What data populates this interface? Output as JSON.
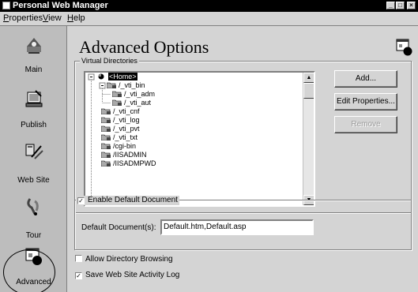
{
  "window": {
    "title": "Personal Web Manager"
  },
  "menu": [
    {
      "label": "Properties",
      "accel": "P"
    },
    {
      "label": "View",
      "accel": "V"
    },
    {
      "label": "Help",
      "accel": "H"
    }
  ],
  "sidebar": {
    "items": [
      {
        "label": "Main",
        "icon": "main-icon"
      },
      {
        "label": "Publish",
        "icon": "publish-icon"
      },
      {
        "label": "Web Site",
        "icon": "web-site-icon"
      },
      {
        "label": "Tour",
        "icon": "tour-icon"
      },
      {
        "label": "Advanced",
        "icon": "advanced-icon",
        "active": true
      }
    ]
  },
  "page": {
    "title": "Advanced Options",
    "virtual_directories_label": "Virtual Directories"
  },
  "tree": {
    "items": [
      {
        "label": "<Home>",
        "selected": true
      },
      {
        "label": "/_vti_bin"
      },
      {
        "label": "/_vti_adm"
      },
      {
        "label": "/_vti_aut"
      },
      {
        "label": "/_vti_cnf"
      },
      {
        "label": "/_vti_log"
      },
      {
        "label": "/_vti_pvt"
      },
      {
        "label": "/_vti_txt"
      },
      {
        "label": "/cgi-bin"
      },
      {
        "label": "/IISADMIN"
      },
      {
        "label": "/IISADMPWD"
      }
    ]
  },
  "buttons": {
    "add": "Add...",
    "edit_properties": "Edit Properties...",
    "remove": "Remove"
  },
  "default_document": {
    "enable_label": "Enable Default Document",
    "enabled": true,
    "field_label": "Default Document(s):",
    "value": "Default.htm,Default.asp"
  },
  "options": {
    "allow_browsing_label": "Allow Directory Browsing",
    "allow_browsing": false,
    "save_log_label": "Save Web Site Activity Log",
    "save_log": true
  }
}
